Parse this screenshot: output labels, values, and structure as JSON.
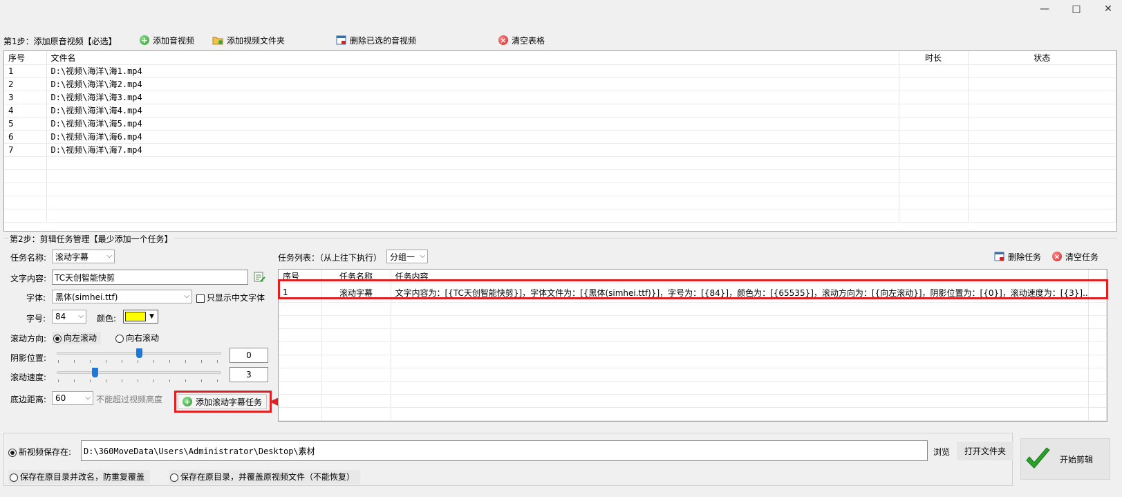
{
  "window": {
    "minimize": "—",
    "maximize": "□",
    "close": "✕"
  },
  "step1": {
    "label": "第1步：添加原音视频【必选】",
    "add_av": "添加音视频",
    "add_folder": "添加视频文件夹",
    "delete_selected": "删除已选的音视频",
    "clear_table": "清空表格",
    "columns": {
      "index": "序号",
      "filename": "文件名",
      "duration": "时长",
      "status": "状态"
    },
    "rows": [
      {
        "index": "1",
        "file": "D:\\视频\\海洋\\海1.mp4"
      },
      {
        "index": "2",
        "file": "D:\\视频\\海洋\\海2.mp4"
      },
      {
        "index": "3",
        "file": "D:\\视频\\海洋\\海3.mp4"
      },
      {
        "index": "4",
        "file": "D:\\视频\\海洋\\海4.mp4"
      },
      {
        "index": "5",
        "file": "D:\\视频\\海洋\\海5.mp4"
      },
      {
        "index": "6",
        "file": "D:\\视频\\海洋\\海6.mp4"
      },
      {
        "index": "7",
        "file": "D:\\视频\\海洋\\海7.mp4"
      }
    ]
  },
  "step2": {
    "label": "第2步：剪辑任务管理【最少添加一个任务】",
    "task_name_label": "任务名称:",
    "task_name_value": "滚动字幕",
    "text_label": "文字内容:",
    "text_value": "TC天创智能快剪",
    "font_label": "字体:",
    "font_value": "黑体(simhei.ttf)",
    "only_cn_label": "只显示中文字体",
    "size_label": "字号:",
    "size_value": "84",
    "color_label": "颜色:",
    "color_value": "#ffff00",
    "direction_label": "滚动方向:",
    "dir_left": "向左滚动",
    "dir_right": "向右滚动",
    "shadow_label": "阴影位置:",
    "shadow_value": "0",
    "shadow_fraction": 0.5,
    "speed_label": "滚动速度:",
    "speed_value": "3",
    "speed_fraction": 0.23,
    "bottom_label": "底边距离:",
    "bottom_value": "60",
    "bottom_hint": "不能超过视频高度",
    "add_task": "添加滚动字幕任务",
    "task_list_label": "任务列表：（从上往下执行）",
    "group_value": "分组一",
    "delete_task": "删除任务",
    "clear_tasks": "清空任务",
    "task_columns": {
      "index": "序号",
      "name": "任务名称",
      "content": "任务内容"
    },
    "tasks": [
      {
        "index": "1",
        "name": "滚动字幕",
        "content": "文字内容为：[{TC天创智能快剪}]，字体文件为：[{黑体(simhei.ttf)}]，字号为：[{84}]，颜色为：[{65535}]，滚动方向为：[{向左滚动}]，阴影位置为：[{0}]，滚动速度为：[{3}]..."
      }
    ]
  },
  "output": {
    "save_new_label": "新视频保存在:",
    "save_path": "D:\\360MoveData\\Users\\Administrator\\Desktop\\素材",
    "browse": "浏览",
    "open_folder": "打开文件夹",
    "save_rename": "保存在原目录并改名，防重复覆盖",
    "save_overwrite": "保存在原目录，并覆盖原视频文件（不能恢复）",
    "start": "开始剪辑"
  },
  "colors": {
    "highlight": "#e02020",
    "accent_blue": "#1e78d7"
  }
}
